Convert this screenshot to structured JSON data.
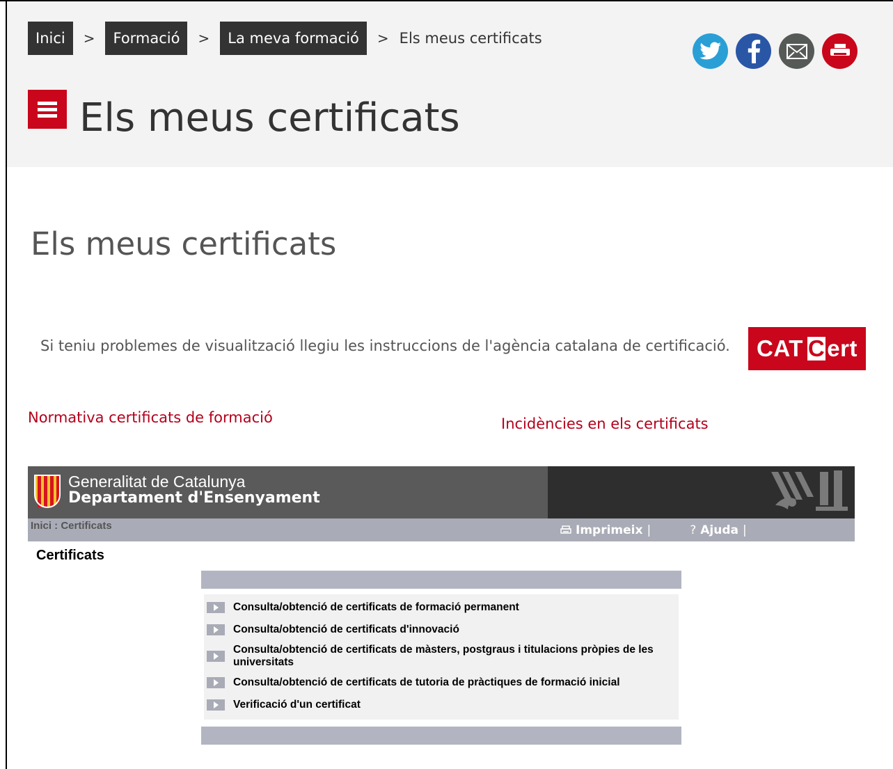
{
  "breadcrumb": {
    "items": [
      "Inici",
      "Formació",
      "La meva formació"
    ],
    "separator": ">",
    "current": "Els meus certificats"
  },
  "social": {
    "icons": [
      "twitter-icon",
      "facebook-icon",
      "email-icon",
      "print-icon"
    ],
    "colors": {
      "twitter": "#2a9fd6",
      "facebook": "#2a56a6",
      "email": "#555a57",
      "print": "#c9061b"
    }
  },
  "header": {
    "title": "Els meus certificats"
  },
  "content": {
    "title": "Els meus certificats",
    "info_text": "Si teniu problemes de visualització llegiu les instruccions de l'agència catalana de certificació.",
    "catcert": {
      "left": "CAT",
      "box": "C",
      "right": "ert"
    },
    "link_normativa": "Normativa certificats de formació",
    "link_incidencies": "Incidències en els certificats"
  },
  "app": {
    "org_line1": "Generalitat de Catalunya",
    "org_line2": "Departament d'Ensenyament",
    "crumb": "Inici : Certificats",
    "tools": {
      "print": "Imprimeix",
      "help": "Ajuda",
      "separator": "|"
    },
    "section_title": "Certificats",
    "items": [
      "Consulta/obtenció de certificats de formació permanent",
      "Consulta/obtenció de certificats d'innovació",
      "Consulta/obtenció de certificats de màsters, postgraus i titulacions pròpies de les universitats",
      "Consulta/obtenció de certificats de tutoria de pràctiques de formació inicial",
      "Verificació d'un certificat"
    ]
  },
  "theme": {
    "accent": "#c9061b",
    "link": "#b3001b",
    "dark": "#333333"
  }
}
